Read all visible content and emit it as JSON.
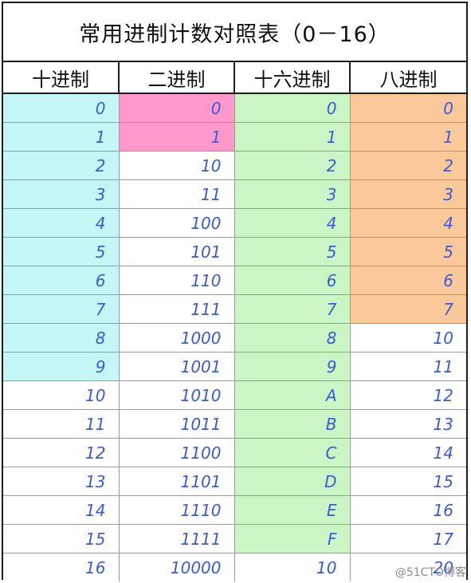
{
  "title": "常用进制计数对照表（0－16）",
  "headers": [
    "十进制",
    "二进制",
    "十六进制",
    "八进制"
  ],
  "colors": {
    "cyan": "#c6f7f7",
    "pink": "#ff99cc",
    "green": "#ccf5c6",
    "orange": "#fbc89a",
    "white": "#ffffff"
  },
  "rows": [
    {
      "cells": [
        "0",
        "0",
        "0",
        "0"
      ],
      "fill": [
        "cyan",
        "pink",
        "green",
        "orange"
      ]
    },
    {
      "cells": [
        "1",
        "1",
        "1",
        "1"
      ],
      "fill": [
        "cyan",
        "pink",
        "green",
        "orange"
      ]
    },
    {
      "cells": [
        "2",
        "10",
        "2",
        "2"
      ],
      "fill": [
        "cyan",
        "white",
        "green",
        "orange"
      ]
    },
    {
      "cells": [
        "3",
        "11",
        "3",
        "3"
      ],
      "fill": [
        "cyan",
        "white",
        "green",
        "orange"
      ]
    },
    {
      "cells": [
        "4",
        "100",
        "4",
        "4"
      ],
      "fill": [
        "cyan",
        "white",
        "green",
        "orange"
      ]
    },
    {
      "cells": [
        "5",
        "101",
        "5",
        "5"
      ],
      "fill": [
        "cyan",
        "white",
        "green",
        "orange"
      ]
    },
    {
      "cells": [
        "6",
        "110",
        "6",
        "6"
      ],
      "fill": [
        "cyan",
        "white",
        "green",
        "orange"
      ]
    },
    {
      "cells": [
        "7",
        "111",
        "7",
        "7"
      ],
      "fill": [
        "cyan",
        "white",
        "green",
        "orange"
      ]
    },
    {
      "cells": [
        "8",
        "1000",
        "8",
        "10"
      ],
      "fill": [
        "cyan",
        "white",
        "green",
        "white"
      ]
    },
    {
      "cells": [
        "9",
        "1001",
        "9",
        "11"
      ],
      "fill": [
        "cyan",
        "white",
        "green",
        "white"
      ]
    },
    {
      "cells": [
        "10",
        "1010",
        "A",
        "12"
      ],
      "fill": [
        "white",
        "white",
        "green",
        "white"
      ]
    },
    {
      "cells": [
        "11",
        "1011",
        "B",
        "13"
      ],
      "fill": [
        "white",
        "white",
        "green",
        "white"
      ]
    },
    {
      "cells": [
        "12",
        "1100",
        "C",
        "14"
      ],
      "fill": [
        "white",
        "white",
        "green",
        "white"
      ]
    },
    {
      "cells": [
        "13",
        "1101",
        "D",
        "15"
      ],
      "fill": [
        "white",
        "white",
        "green",
        "white"
      ]
    },
    {
      "cells": [
        "14",
        "1110",
        "E",
        "16"
      ],
      "fill": [
        "white",
        "white",
        "green",
        "white"
      ]
    },
    {
      "cells": [
        "15",
        "1111",
        "F",
        "17"
      ],
      "fill": [
        "white",
        "white",
        "green",
        "white"
      ]
    },
    {
      "cells": [
        "16",
        "10000",
        "10",
        "20"
      ],
      "fill": [
        "white",
        "white",
        "white",
        "white"
      ]
    }
  ],
  "watermark": "@51CTO博客"
}
